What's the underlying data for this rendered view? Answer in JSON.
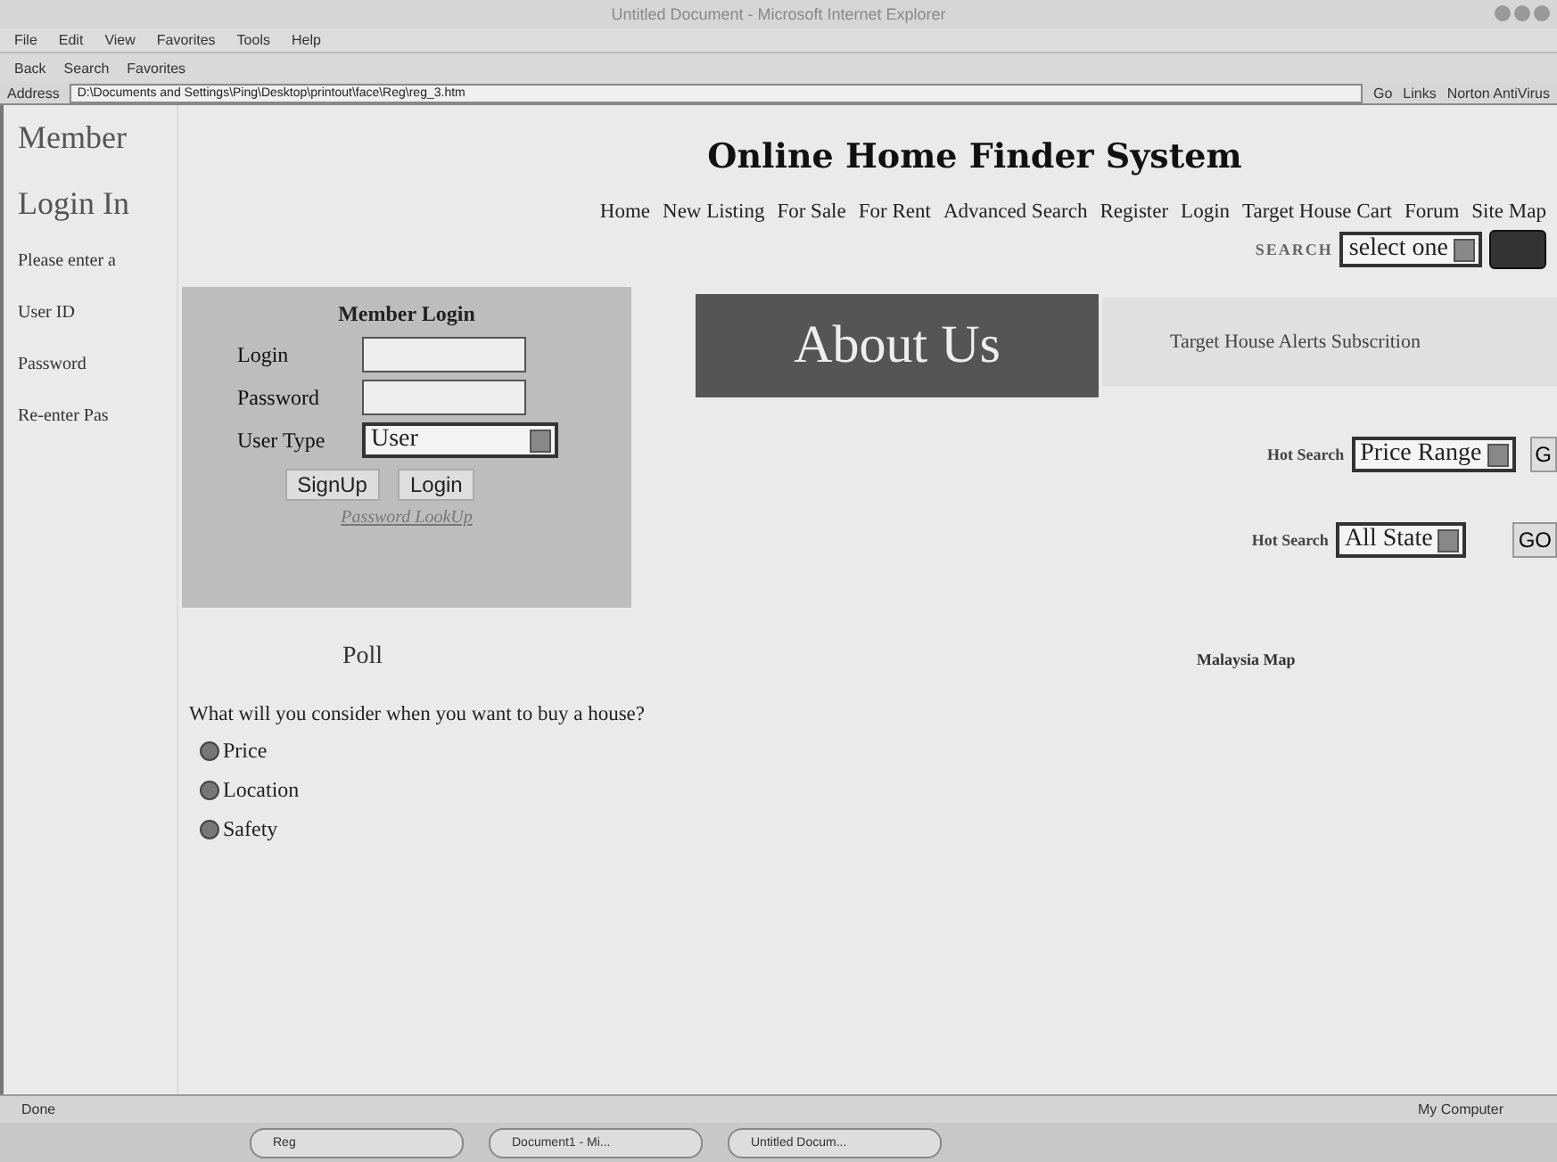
{
  "window": {
    "title": "Untitled Document - Microsoft Internet Explorer"
  },
  "menu": [
    "File",
    "Edit",
    "View",
    "Favorites",
    "Tools",
    "Help"
  ],
  "toolbar": {
    "back": "Back",
    "search": "Search",
    "favorites": "Favorites"
  },
  "address_bar": {
    "label": "Address",
    "url": "D:\\Documents and Settings\\Ping\\Desktop\\printout\\face\\Reg\\reg_3.htm",
    "go": "Go",
    "links": "Links",
    "norton": "Norton AntiVirus"
  },
  "sidebar": {
    "heading_1": "Member",
    "heading_2": "Login In",
    "items": [
      "Please enter a",
      "User ID",
      "Password",
      "Re-enter Pas"
    ]
  },
  "page": {
    "title": "Online Home Finder System",
    "nav": [
      "Home",
      "New Listing",
      "For Sale",
      "For Rent",
      "Advanced Search",
      "Register",
      "Login",
      "Target House Cart",
      "Forum",
      "Site Map"
    ],
    "search": {
      "label": "SEARCH",
      "value": "select one"
    },
    "member_login": {
      "title": "Member Login",
      "login_label": "Login",
      "password_label": "Password",
      "user_type_label": "User Type",
      "user_type": "User",
      "buttons": [
        "SignUp",
        "Login"
      ],
      "lookup": "Password LookUp"
    },
    "about_banner": "About Us",
    "alerts": "Target House Alerts Subscrition",
    "hot_searches": [
      {
        "label": "Hot Search",
        "value": "Price Range",
        "button": "G"
      },
      {
        "label": "Hot Search",
        "value": "All State",
        "button": "GO"
      }
    ],
    "map_label": "Malaysia Map",
    "poll": {
      "title": "Poll",
      "question": "What will you consider when you want to buy a house?",
      "options": [
        "Price",
        "Location",
        "Safety"
      ]
    }
  },
  "status_bar": {
    "text": "Done",
    "zone": "My Computer"
  },
  "taskbar": [
    "Reg",
    "Document1 - Mi...",
    "Untitled Docum..."
  ]
}
